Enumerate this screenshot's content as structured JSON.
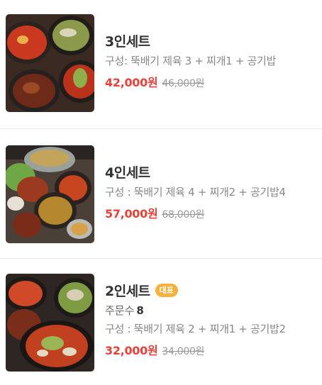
{
  "menu": {
    "items": [
      {
        "title": "3인세트",
        "description": "구성: 뚝배기 제육 3 + 찌개1 + 공기밥",
        "price": "42,000원",
        "original_price": "46,000원",
        "image": "korean-set-meal-photo"
      },
      {
        "title": "4인세트",
        "description": "구성 : 뚝배기 제육 4 + 찌개2 + 공기밥4",
        "price": "57,000원",
        "original_price": "68,000원",
        "image": "korean-set-meal-photo"
      },
      {
        "title": "2인세트",
        "badge": "대표",
        "orders_label": "주문수",
        "orders_count": "8",
        "description": "구성 : 뚝배기 제육 2 + 찌개1 + 공기밥2",
        "price": "32,000원",
        "original_price": "34,000원",
        "image": "korean-set-meal-photo"
      }
    ]
  },
  "colors": {
    "price": "#e8413a",
    "badge": "#f7b23b",
    "divider": "#ececec"
  }
}
